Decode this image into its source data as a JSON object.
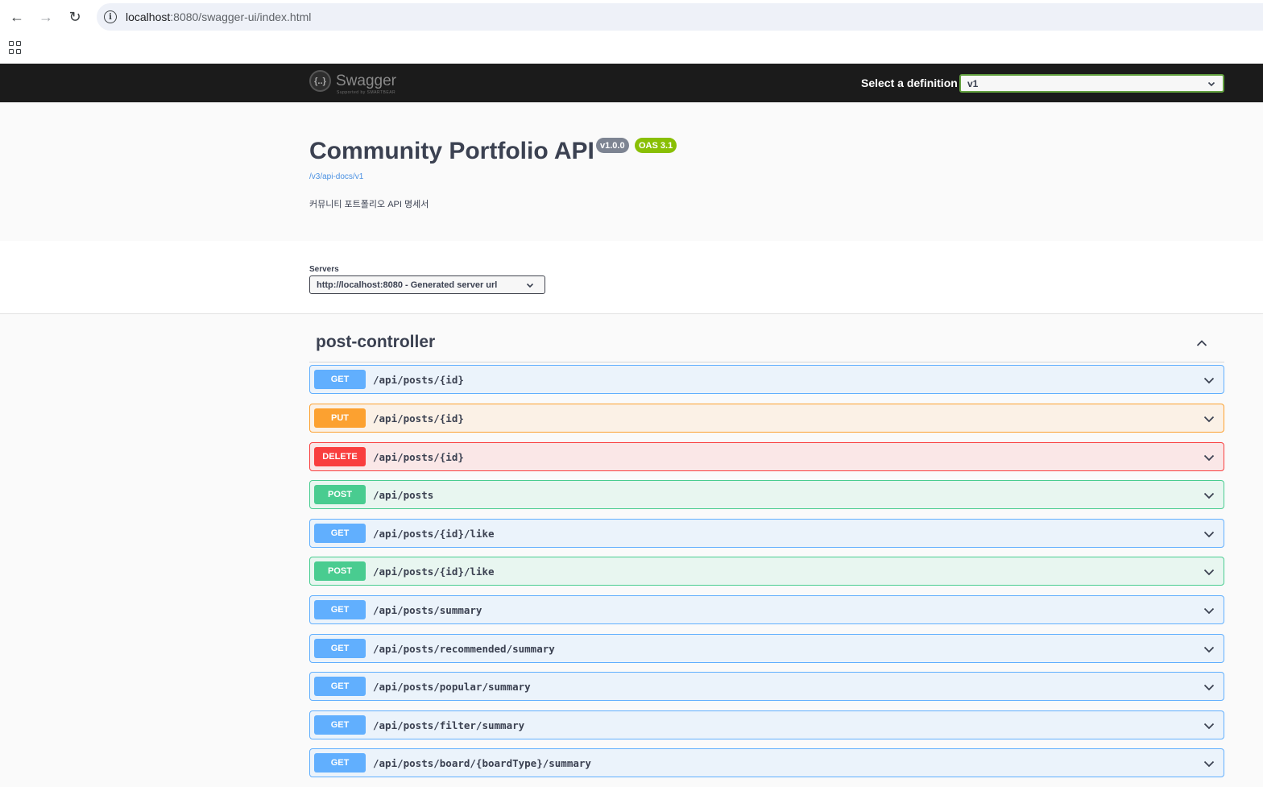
{
  "browser": {
    "url_host": "localhost",
    "url_rest": ":8080/swagger-ui/index.html"
  },
  "topbar": {
    "logo_text": "Swagger",
    "logo_sub": "Supported by SMARTBEAR",
    "definition_label": "Select a definition",
    "definition_value": "v1"
  },
  "info": {
    "title": "Community Portfolio API",
    "version_badge": "v1.0.0",
    "oas_badge": "OAS 3.1",
    "url": "/v3/api-docs/v1",
    "description": "커뮤니티 포트폴리오 API 명세서"
  },
  "servers": {
    "label": "Servers",
    "selected": "http://localhost:8080 - Generated server url"
  },
  "tag": {
    "name": "post-controller"
  },
  "operations": [
    {
      "method": "GET",
      "path": "/api/posts/{id}"
    },
    {
      "method": "PUT",
      "path": "/api/posts/{id}"
    },
    {
      "method": "DELETE",
      "path": "/api/posts/{id}"
    },
    {
      "method": "POST",
      "path": "/api/posts"
    },
    {
      "method": "GET",
      "path": "/api/posts/{id}/like"
    },
    {
      "method": "POST",
      "path": "/api/posts/{id}/like"
    },
    {
      "method": "GET",
      "path": "/api/posts/summary"
    },
    {
      "method": "GET",
      "path": "/api/posts/recommended/summary"
    },
    {
      "method": "GET",
      "path": "/api/posts/popular/summary"
    },
    {
      "method": "GET",
      "path": "/api/posts/filter/summary"
    },
    {
      "method": "GET",
      "path": "/api/posts/board/{boardType}/summary"
    }
  ],
  "colors": {
    "get": "#61affe",
    "put": "#fca130",
    "delete": "#f93e3e",
    "post": "#49cc90"
  }
}
